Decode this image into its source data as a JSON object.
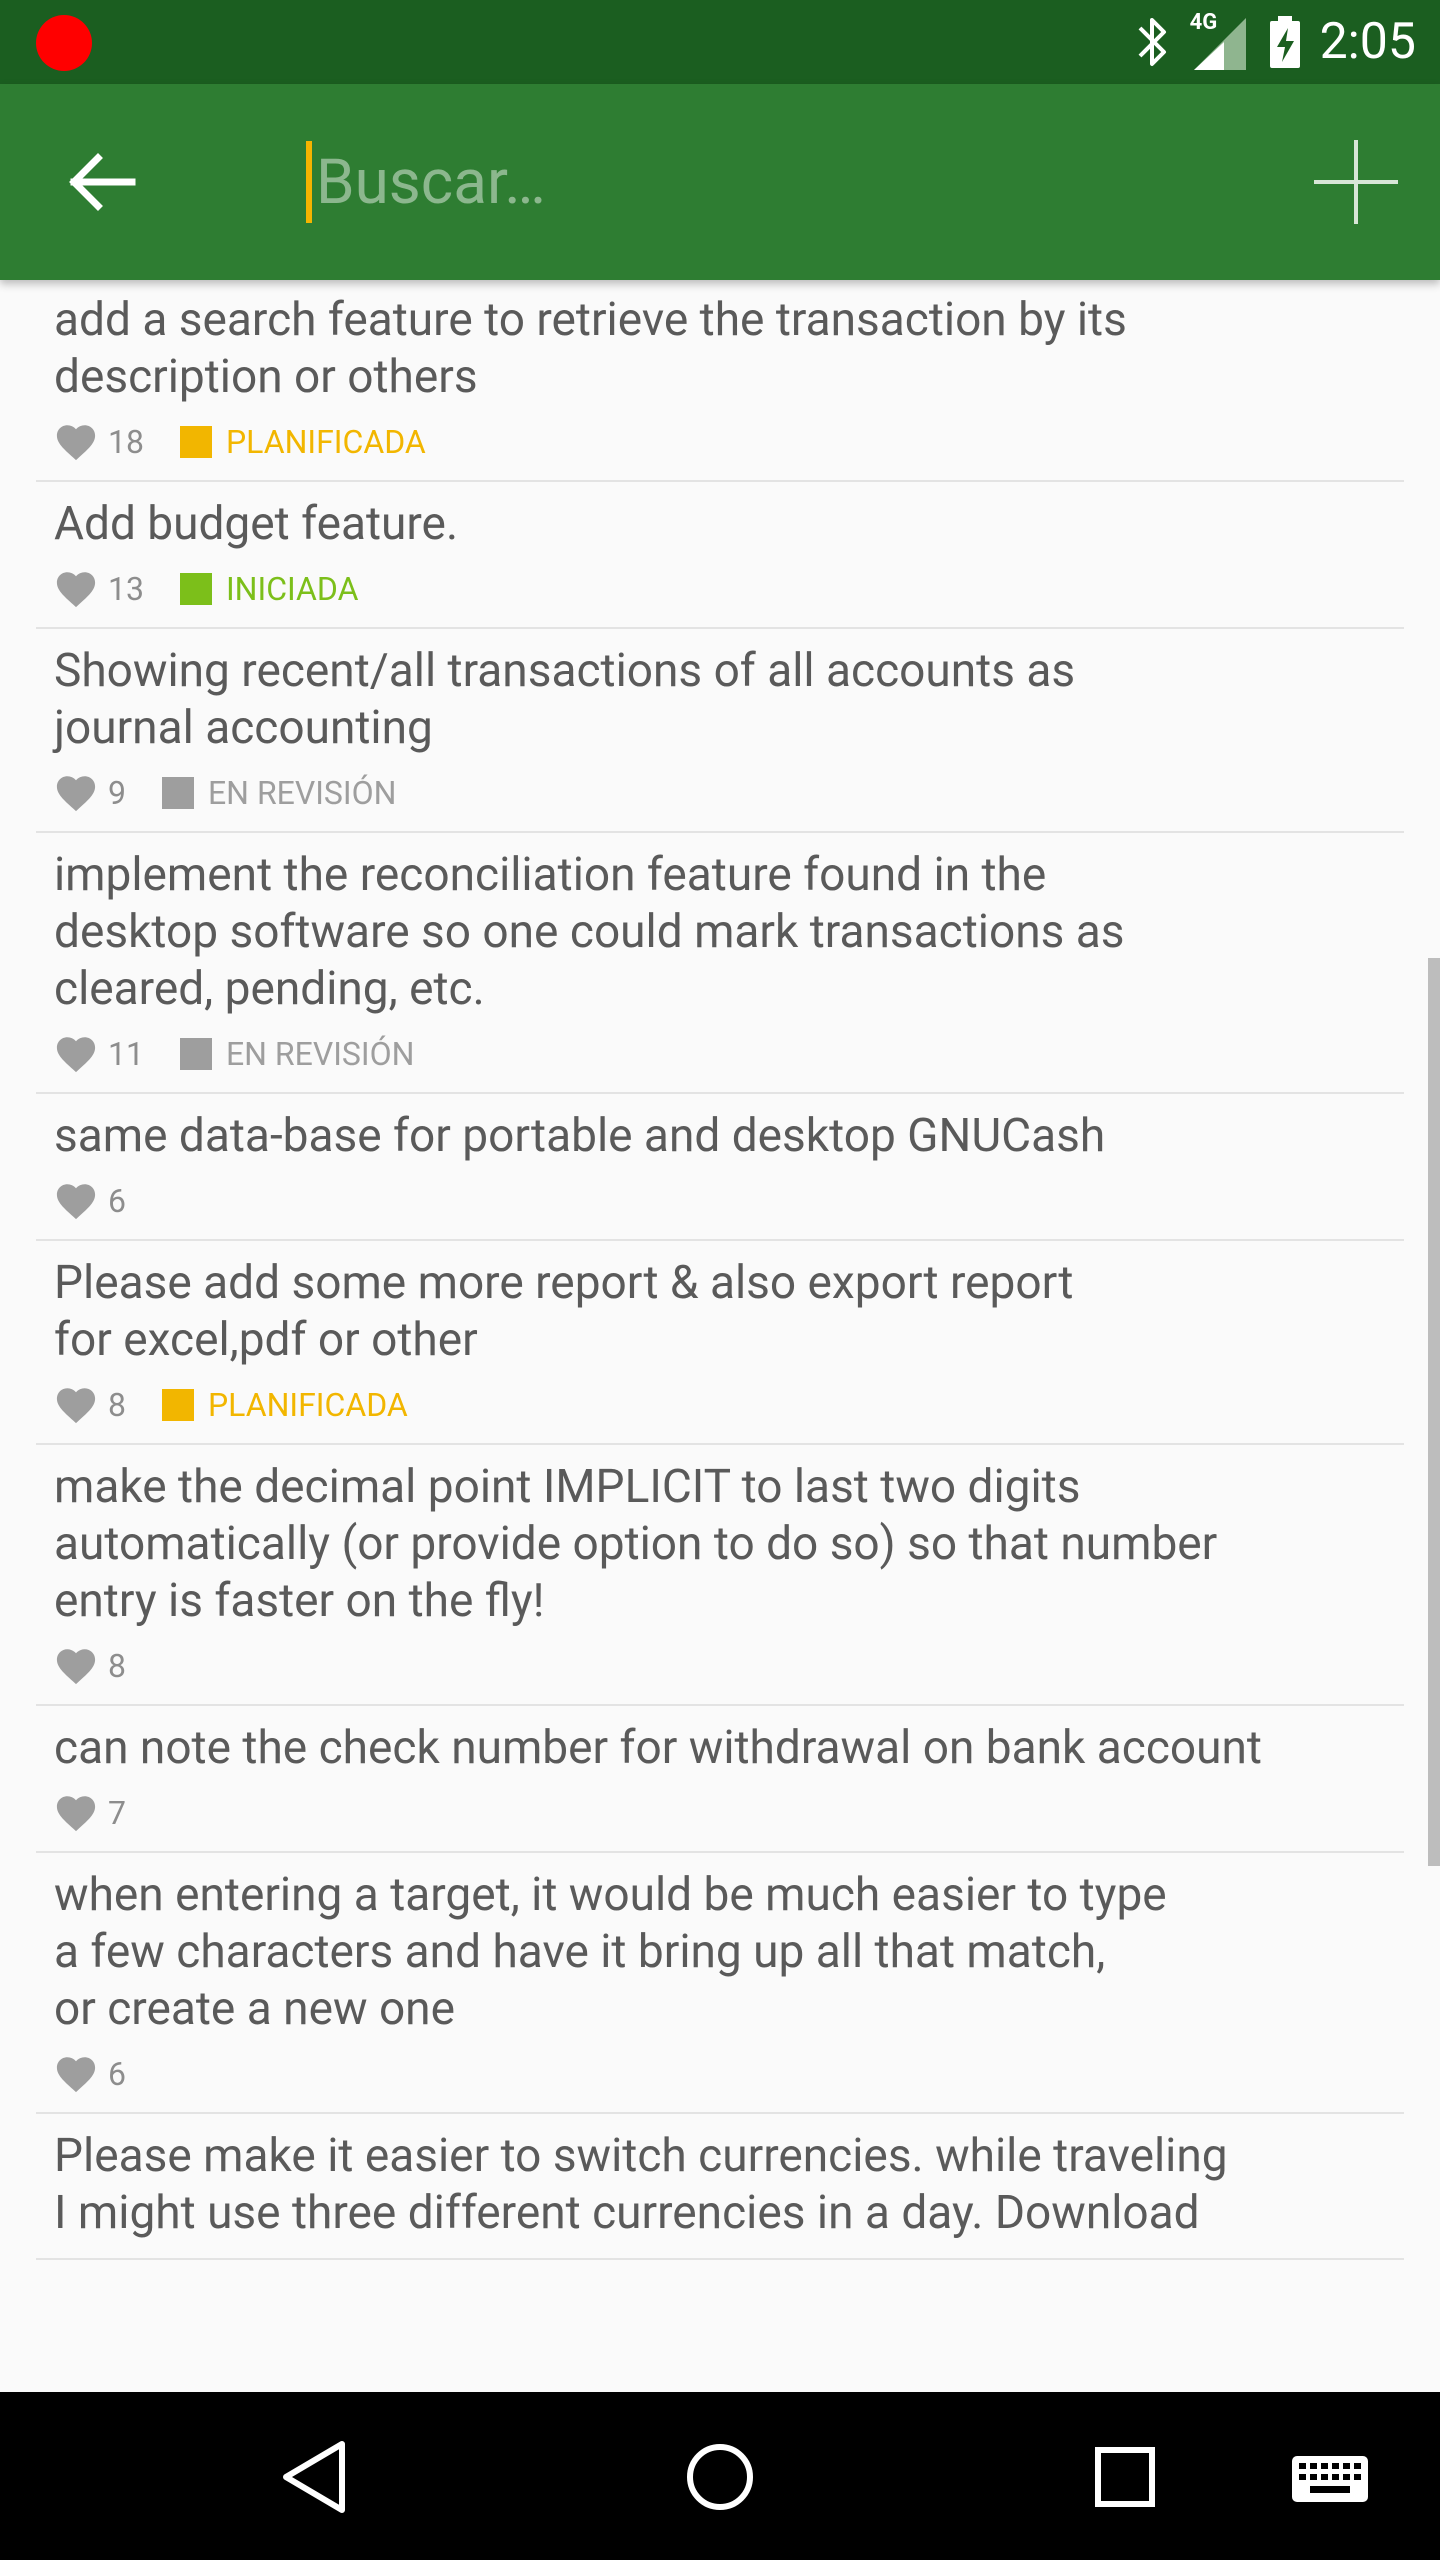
{
  "status_bar": {
    "time": "2:05",
    "network": "4G"
  },
  "search": {
    "placeholder": "Buscar…",
    "value": ""
  },
  "colors": {
    "status_bar": "#1b5e20",
    "app_bar": "#2e7d32",
    "planned": "#f2b600",
    "started": "#7cbf1a",
    "review": "#9e9e9e"
  },
  "items": [
    {
      "title": "add a search feature to retrieve the transaction by its\ndescription or others",
      "votes": "18",
      "status": "PLANIFICADA",
      "status_color": "#f2b600"
    },
    {
      "title": "Add budget feature.",
      "votes": "13",
      "status": "INICIADA",
      "status_color": "#7cbf1a"
    },
    {
      "title": "Showing recent/all transactions of all accounts as\njournal accounting",
      "votes": "9",
      "status": "EN REVISIÓN",
      "status_color": "#9e9e9e"
    },
    {
      "title": "implement the reconciliation feature found in the\ndesktop software so one could mark transactions as\ncleared, pending, etc.",
      "votes": "11",
      "status": "EN REVISIÓN",
      "status_color": "#9e9e9e"
    },
    {
      "title": "same data-base for portable and desktop GNUCash",
      "votes": "6",
      "status": "",
      "status_color": ""
    },
    {
      "title": "Please add some more report & also export report\nfor excel,pdf or other",
      "votes": "8",
      "status": "PLANIFICADA",
      "status_color": "#f2b600"
    },
    {
      "title": "make the decimal point IMPLICIT to last two digits\nautomatically (or provide option to do so) so that number\nentry is faster on the fly!",
      "votes": "8",
      "status": "",
      "status_color": ""
    },
    {
      "title": "can note the check number for withdrawal on bank account",
      "votes": "7",
      "status": "",
      "status_color": ""
    },
    {
      "title": "when entering a target, it would be much easier to type\na few characters and have it bring up all that match,\nor create a new one",
      "votes": "6",
      "status": "",
      "status_color": ""
    },
    {
      "title": "Please make it easier to switch currencies. while traveling\nI might use three different currencies in a day. Download",
      "votes": "",
      "status": "",
      "status_color": ""
    }
  ]
}
